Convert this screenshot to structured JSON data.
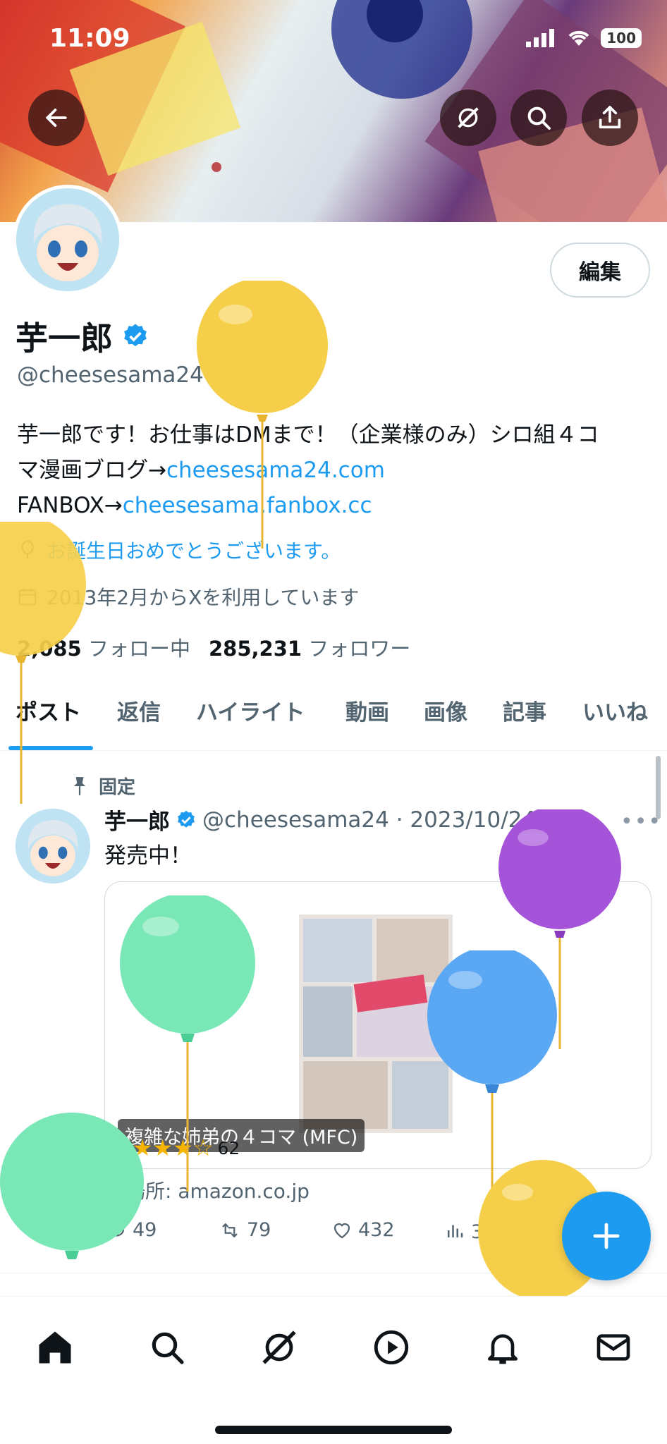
{
  "status_bar": {
    "time": "11:09",
    "battery": "100"
  },
  "profile": {
    "name": "芋一郎",
    "handle": "@cheesesama24",
    "edit_label": "編集",
    "bio_line1": "芋一郎です！お仕事はDMまで！（企業様のみ）シロ組４コ",
    "bio_line2_prefix": "マ漫画ブログ→",
    "bio_link1": "cheesesama24.com",
    "bio_line3_prefix": "FANBOX→",
    "bio_link2": "cheesesama.fanbox.cc",
    "birthday": "お誕生日おめでとうございます。",
    "joined": "2013年2月からXを利用しています",
    "following_count": "2,085",
    "following_label": "フォロー中",
    "followers_count": "285,231",
    "followers_label": "フォロワー"
  },
  "tabs": [
    "ポスト",
    "返信",
    "ハイライト",
    "動画",
    "画像",
    "記事",
    "いいね"
  ],
  "post": {
    "pinned_label": "固定",
    "author": "芋一郎",
    "handle_date": "@cheesesama24 · 2023/10/24",
    "text": "発売中！",
    "card_title": "複雑な姉弟の４コマ (MFC)",
    "rating_count": "62",
    "rating_value": 4.5,
    "source": "場所: amazon.co.jp",
    "replies": "49",
    "reposts": "79",
    "likes": "432",
    "views": "356万"
  },
  "icons": {
    "back": "back-arrow-icon",
    "grok": "grok-icon",
    "search": "search-icon",
    "share": "share-icon",
    "verified": "verified-badge-icon",
    "location": "balloon-icon",
    "calendar": "calendar-icon",
    "pin": "pin-icon",
    "compose": "plus-icon"
  },
  "colors": {
    "accent": "#1d9bf0",
    "text": "#0f1419",
    "muted": "#536471"
  }
}
